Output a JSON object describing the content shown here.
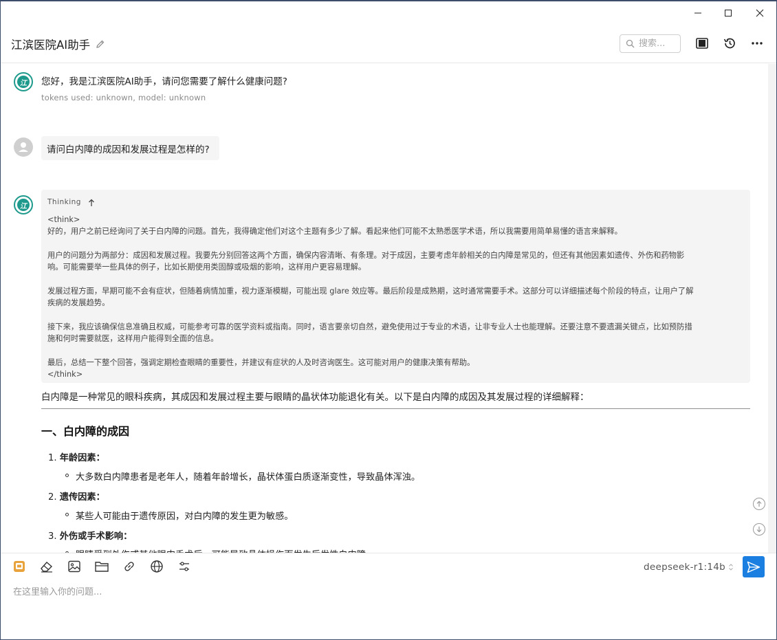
{
  "window": {
    "minimize_label": "—",
    "maximize_label": "☐",
    "close_label": "✕"
  },
  "header": {
    "title": "江滨医院AI助手",
    "search_placeholder": "搜索..."
  },
  "messages": {
    "greeting": "您好，我是江滨医院AI助手，请问您需要了解什么健康问题?",
    "greeting_meta": "tokens used: unknown, model: unknown",
    "user_question": "请问白内障的成因和发展过程是怎样的?",
    "thinking_label": "Thinking",
    "think_lines": [
      "<think>",
      "好的，用户之前已经询问了关于白内障的问题。首先，我得确定他们对这个主题有多少了解。看起来他们可能不太熟悉医学术语，所以我需要用简单易懂的语言来解释。",
      "",
      "用户的问题分为两部分：成因和发展过程。我要先分别回答这两个方面，确保内容清晰、有条理。对于成因，主要考虑年龄相关的白内障是常见的，但还有其他因素如遗传、外伤和药物影",
      "响。可能需要举一些具体的例子，比如长期使用类固醇或吸烟的影响，这样用户更容易理解。",
      "",
      "发展过程方面，早期可能不会有症状，但随着病情加重，视力逐渐模糊，可能出现 glare 效应等。最后阶段是成熟期，这时通常需要手术。这部分可以详细描述每个阶段的特点，让用户了解",
      "疾病的发展趋势。",
      "",
      "接下来，我应该确保信息准确且权威，可能参考可靠的医学资料或指南。同时，语言要亲切自然，避免使用过于专业的术语，让非专业人士也能理解。还要注意不要遗漏关键点，比如预防措",
      "施和何时需要就医，这样用户能得到全面的信息。",
      "",
      "最后，总结一下整个回答，强调定期检查眼睛的重要性，并建议有症状的人及时咨询医生。这可能对用户的健康决策有帮助。",
      "</think>"
    ],
    "answer_intro": "白内障是一种常见的眼科疾病，其成因和发展过程主要与眼睛的晶状体功能退化有关。以下是白内障的成因及其发展过程的详细解释：",
    "section_heading": "一、白内障的成因",
    "list": [
      {
        "num": "1.",
        "title": "年龄因素：",
        "detail": "大多数白内障患者是老年人，随着年龄增长，晶状体蛋白质逐渐变性，导致晶体浑浊。"
      },
      {
        "num": "2.",
        "title": "遗传因素：",
        "detail": "某些人可能由于遗传原因，对白内障的发生更为敏感。"
      },
      {
        "num": "3.",
        "title": "外伤或手术影响：",
        "detail": "眼睛受到外伤或其他眼内手术后，可能导致晶体损伤而发生后发性白内障。"
      }
    ]
  },
  "composer": {
    "model": "deepseek-r1:14b",
    "placeholder": "在这里输入你的问题..."
  },
  "colors": {
    "accent": "#1a7fe0",
    "brand_teal": "#1e9a8c"
  }
}
